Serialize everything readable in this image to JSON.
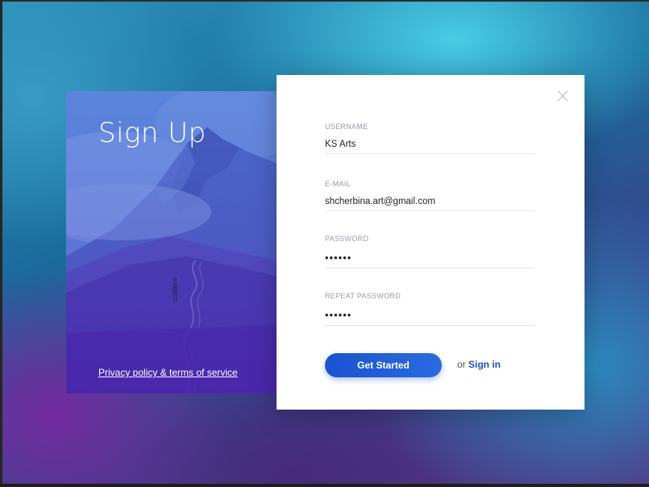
{
  "colors": {
    "accent": "#1a53d0",
    "link": "#1c4fcf",
    "panel_gradient_top": "#6a86d8",
    "panel_gradient_bottom": "#4a2aa8"
  },
  "icons": {
    "close": "close-icon"
  },
  "hero": {
    "title": "Sign Up",
    "privacy_link": "Privacy policy & terms of service"
  },
  "form": {
    "username": {
      "label": "USERNAME",
      "value": "KS Arts"
    },
    "email": {
      "label": "E-MAIL",
      "value": "shcherbina.art@gmail.com"
    },
    "password": {
      "label": "PASSWORD",
      "value": "••••••"
    },
    "repeat_password": {
      "label": "REPEAT PASSWORD",
      "value": "••••••"
    },
    "submit_label": "Get Started",
    "alt_prefix": "or",
    "alt_link": "Sign in"
  }
}
